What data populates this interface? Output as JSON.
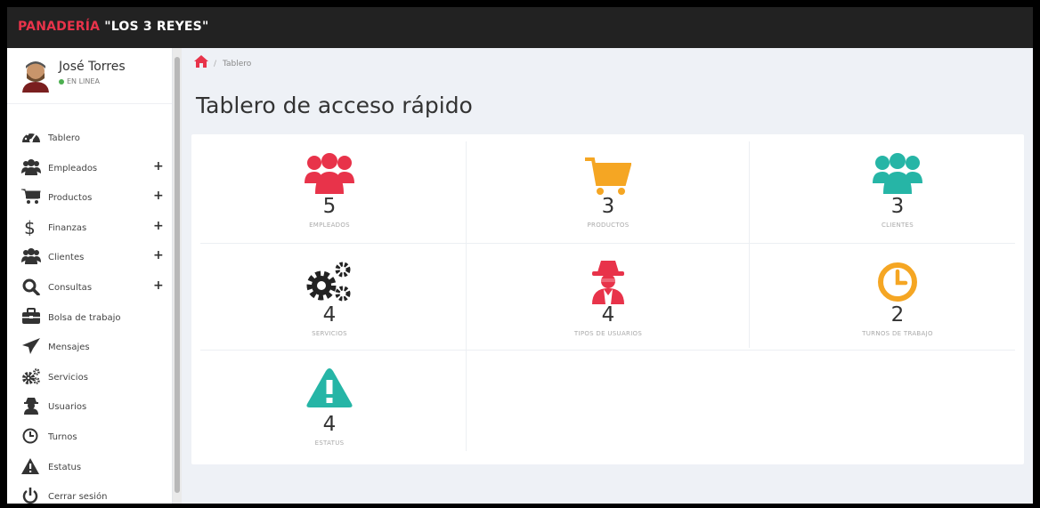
{
  "app": {
    "brand_part1": "PANADERÍA",
    "brand_part2": "\"LOS 3 REYES\""
  },
  "user": {
    "name": "José Torres",
    "status": "EN LINEA"
  },
  "sidebar": {
    "items": [
      {
        "label": "Tablero",
        "icon": "dashboard-icon",
        "expandable": false
      },
      {
        "label": "Empleados",
        "icon": "users-icon",
        "expandable": true
      },
      {
        "label": "Productos",
        "icon": "cart-icon",
        "expandable": true
      },
      {
        "label": "Finanzas",
        "icon": "dollar-icon",
        "expandable": true
      },
      {
        "label": "Clientes",
        "icon": "users-icon",
        "expandable": true
      },
      {
        "label": "Consultas",
        "icon": "search-icon",
        "expandable": true
      },
      {
        "label": "Bolsa de trabajo",
        "icon": "briefcase-icon",
        "expandable": false
      },
      {
        "label": "Mensajes",
        "icon": "send-icon",
        "expandable": false
      },
      {
        "label": "Servicios",
        "icon": "cogs-icon",
        "expandable": false
      },
      {
        "label": "Usuarios",
        "icon": "user-secret-icon",
        "expandable": false
      },
      {
        "label": "Turnos",
        "icon": "clock-icon",
        "expandable": false
      },
      {
        "label": "Estatus",
        "icon": "warning-icon",
        "expandable": false
      },
      {
        "label": "Cerrar sesión",
        "icon": "power-icon",
        "expandable": false
      }
    ],
    "plus_symbol": "+"
  },
  "breadcrumb": {
    "separator": "/",
    "current": "Tablero"
  },
  "page": {
    "title": "Tablero de acceso rápido"
  },
  "tiles": [
    {
      "count": "5",
      "label": "EMPLEADOS",
      "icon": "users-icon",
      "color": "#e8334a"
    },
    {
      "count": "3",
      "label": "PRODUCTOS",
      "icon": "cart-icon",
      "color": "#f5a623"
    },
    {
      "count": "3",
      "label": "CLIENTES",
      "icon": "users-icon",
      "color": "#26b5a6"
    },
    {
      "count": "4",
      "label": "SERVICIOS",
      "icon": "cogs-icon",
      "color": "#222222"
    },
    {
      "count": "4",
      "label": "TIPOS DE USUARIOS",
      "icon": "user-secret-icon",
      "color": "#e8334a"
    },
    {
      "count": "2",
      "label": "TURNOS DE TRABAJO",
      "icon": "clock-icon",
      "color": "#f5a623"
    },
    {
      "count": "4",
      "label": "ESTATUS",
      "icon": "warning-icon",
      "color": "#26b5a6"
    }
  ]
}
